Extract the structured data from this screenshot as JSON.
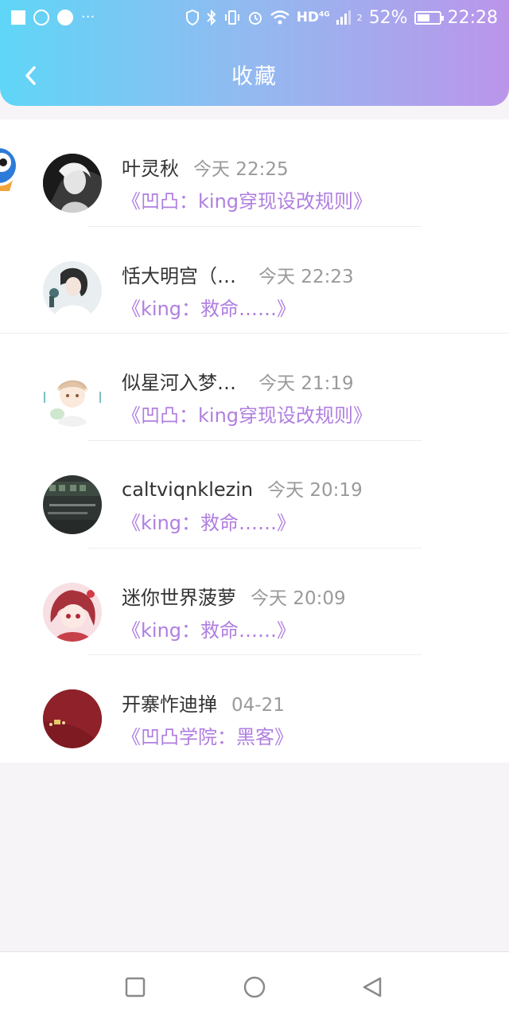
{
  "status_bar": {
    "battery": "52%",
    "time": "22:28",
    "network": "HD",
    "network_gen": "4G",
    "sim": "2",
    "more": "···"
  },
  "header": {
    "title": "收藏"
  },
  "items": [
    {
      "name": "叶灵秋",
      "time": "今天 22:25",
      "work": "《凹凸：king穿现设改规则》"
    },
    {
      "name": "恬大明宫（…",
      "time": "今天 22:23",
      "work": "《king：救命……》"
    },
    {
      "name": "似星河入梦…",
      "time": "今天 21:19",
      "work": "《凹凸：king穿现设改规则》"
    },
    {
      "name": "caltviqnklezin",
      "time": "今天 20:19",
      "work": "《king：救命……》"
    },
    {
      "name": "迷你世界菠萝",
      "time": "今天 20:09",
      "work": "《king：救命……》"
    },
    {
      "name": "开寨怍迪掸",
      "time": "04-21",
      "work": "《凹凸学院：黑客》"
    }
  ],
  "colors": {
    "header_gradient_start": "#5fd6f7",
    "header_gradient_end": "#bb95ea",
    "work_title": "#b07fe0",
    "timestamp": "#9a9a9a"
  },
  "nav": {
    "icons": [
      "recents-square-icon",
      "home-circle-icon",
      "back-triangle-icon"
    ]
  }
}
